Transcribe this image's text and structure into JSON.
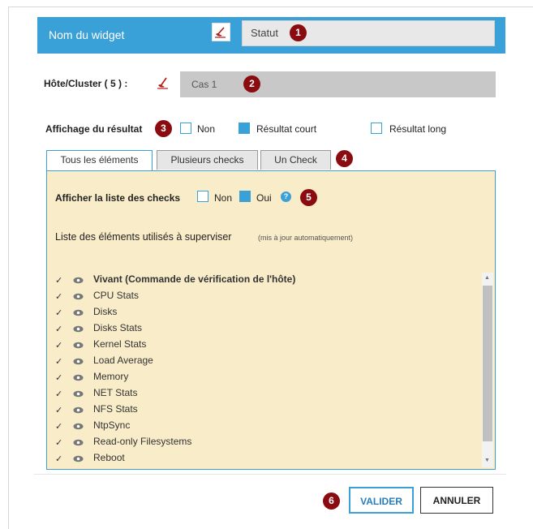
{
  "header": {
    "title": "Nom du widget",
    "input_value": "Statut",
    "badge": "1"
  },
  "host": {
    "label": "Hôte/Cluster ( 5 ) :",
    "value": "Cas 1",
    "badge": "2"
  },
  "display": {
    "label": "Affichage du résultat",
    "badge": "3",
    "options": [
      {
        "label": "Non",
        "checked": false
      },
      {
        "label": "Résultat court",
        "checked": true
      },
      {
        "label": "Résultat long",
        "checked": false
      }
    ]
  },
  "tabs": {
    "items": [
      "Tous les éléments",
      "Plusieurs checks",
      "Un Check"
    ],
    "active": 0,
    "badge": "4"
  },
  "show_checks": {
    "label": "Afficher la liste des checks",
    "no_label": "Non",
    "yes_label": "Oui",
    "selected": "Oui",
    "badge": "5",
    "help_icon": "?"
  },
  "elements": {
    "title": "Liste des éléments utilisés à superviser",
    "subtitle": "(mis à jour automatiquement)",
    "items": [
      "Vivant (Commande de vérification de l'hôte)",
      "CPU Stats",
      "Disks",
      "Disks Stats",
      "Kernel Stats",
      "Load Average",
      "Memory",
      "NET Stats",
      "NFS Stats",
      "NtpSync",
      "Read-only Filesystems",
      "Reboot"
    ],
    "check_glyph": "✓"
  },
  "footer": {
    "validate_label": "VALIDER",
    "cancel_label": "ANNULER",
    "badge": "6"
  },
  "colors": {
    "accent": "#3aa0d8",
    "badge": "#8a0c10",
    "panel": "#f9ecc9"
  }
}
